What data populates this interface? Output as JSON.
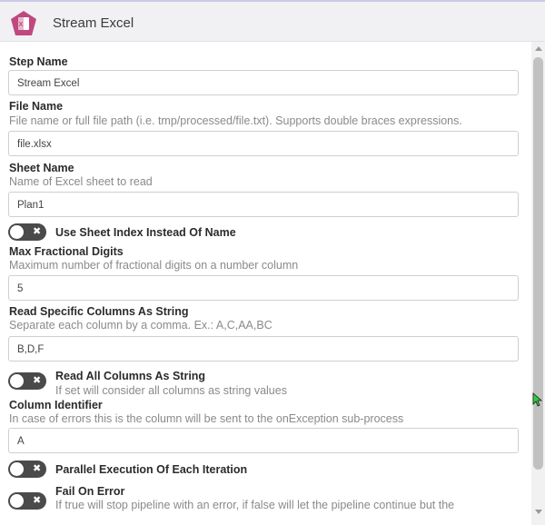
{
  "header": {
    "title": "Stream Excel",
    "logo_icon": "excel-file-icon",
    "accent": "#c0487f"
  },
  "fields": {
    "step_name": {
      "label": "Step Name",
      "value": "Stream Excel"
    },
    "file_name": {
      "label": "File Name",
      "description": "File name or full file path (i.e. tmp/processed/file.txt). Supports double braces expressions.",
      "value": "file.xlsx"
    },
    "sheet_name": {
      "label": "Sheet Name",
      "description": "Name of Excel sheet to read",
      "value": "Plan1"
    },
    "use_sheet_index": {
      "label": "Use Sheet Index Instead Of Name",
      "state": "off"
    },
    "max_fractional_digits": {
      "label": "Max Fractional Digits",
      "description": "Maximum number of fractional digits on a number column",
      "value": "5"
    },
    "read_specific_columns": {
      "label": "Read Specific Columns As String",
      "description": "Separate each column by a comma. Ex.: A,C,AA,BC",
      "value": "B,D,F"
    },
    "read_all_columns": {
      "label": "Read All Columns As String",
      "description": "If set will consider all columns as string values",
      "state": "off"
    },
    "column_identifier": {
      "label": "Column Identifier",
      "description": "In case of errors this is the column will be sent to the onException sub-process",
      "value": "A"
    },
    "parallel_execution": {
      "label": "Parallel Execution Of Each Iteration",
      "state": "off"
    },
    "fail_on_error": {
      "label": "Fail On Error",
      "description": "If true will stop pipeline with an error, if false will let the pipeline continue but the",
      "state": "off"
    }
  },
  "toggle_off_symbol": "✖",
  "colors": {
    "toggle_off": "#4a4a4a",
    "header_bg": "#f1f1f3"
  }
}
